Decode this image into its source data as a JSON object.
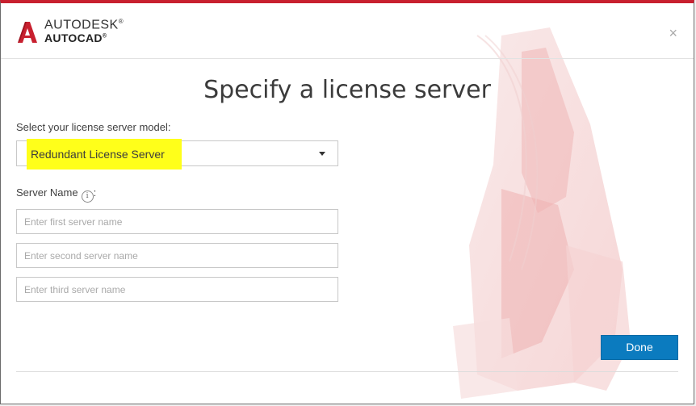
{
  "brand": {
    "line1": "AUTODESK",
    "line1_mark": "®",
    "line2": "AUTOCAD",
    "line2_mark": "®",
    "logo_icon": "autocad-a-logo"
  },
  "close_icon": "×",
  "title": "Specify a license server",
  "model": {
    "label": "Select your license server model:",
    "value": "Redundant License Server",
    "highlight_color": "#ffff1a"
  },
  "server": {
    "label": "Server Name",
    "label_suffix": ":",
    "info_icon": "i",
    "inputs": [
      {
        "placeholder": "Enter first server name",
        "value": ""
      },
      {
        "placeholder": "Enter second server name",
        "value": ""
      },
      {
        "placeholder": "Enter third server name",
        "value": ""
      }
    ]
  },
  "done_label": "Done",
  "colors": {
    "accent": "#c8202f",
    "primary_button": "#0b7bbf"
  }
}
